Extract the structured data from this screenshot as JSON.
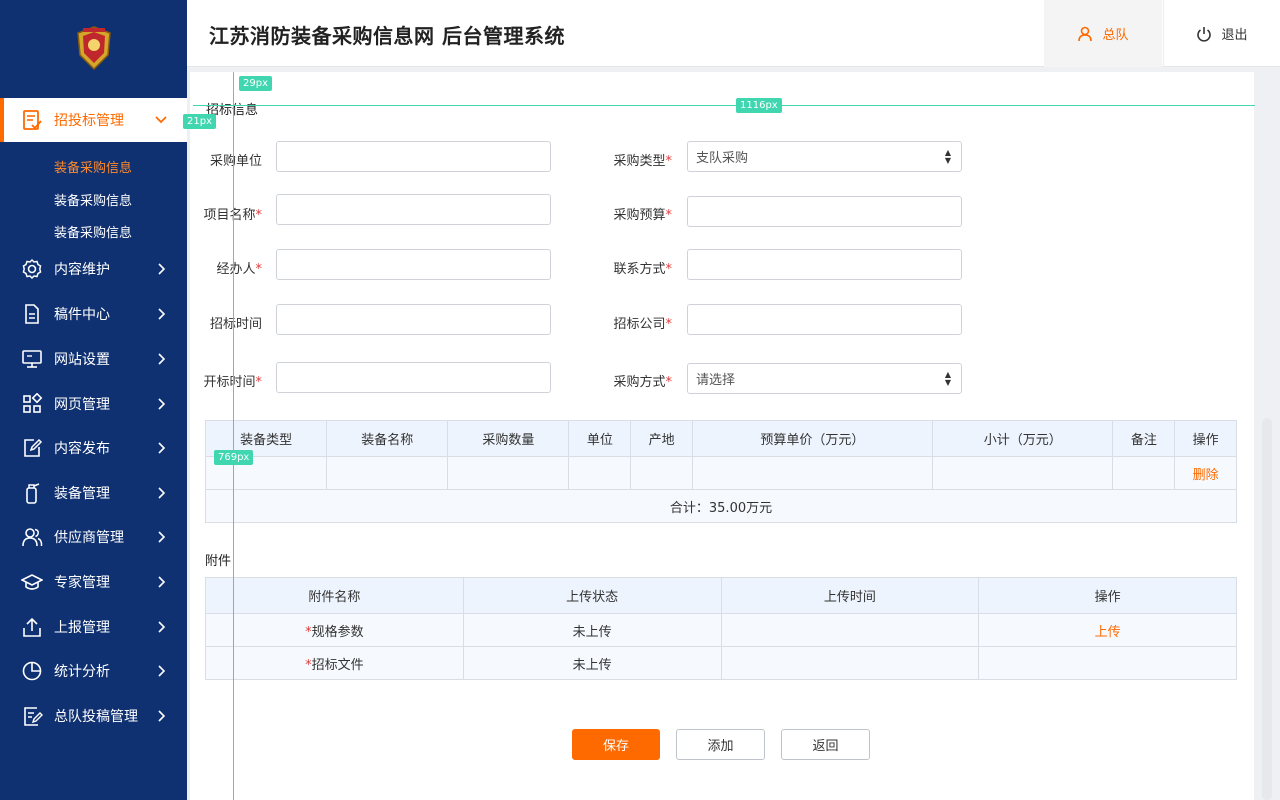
{
  "header": {
    "title": "江苏消防装备采购信息网  后台管理系统",
    "user_label": "总队",
    "logout_label": "退出"
  },
  "sidebar": {
    "active": {
      "label": "招投标管理",
      "icon": "document-check-icon"
    },
    "sub_items": [
      "装备采购信息",
      "装备采购信息",
      "装备采购信息"
    ],
    "items": [
      {
        "label": "内容维护",
        "icon": "gear-icon"
      },
      {
        "label": "稿件中心",
        "icon": "file-icon"
      },
      {
        "label": "网站设置",
        "icon": "monitor-icon"
      },
      {
        "label": "网页管理",
        "icon": "grid-icon"
      },
      {
        "label": "内容发布",
        "icon": "edit-icon"
      },
      {
        "label": "装备管理",
        "icon": "extinguisher-icon"
      },
      {
        "label": "供应商管理",
        "icon": "users-icon"
      },
      {
        "label": "专家管理",
        "icon": "graduation-icon"
      },
      {
        "label": "上报管理",
        "icon": "upload-icon"
      },
      {
        "label": "统计分析",
        "icon": "pie-chart-icon"
      },
      {
        "label": "总队投稿管理",
        "icon": "list-edit-icon"
      }
    ]
  },
  "form": {
    "section_title": "招标信息",
    "fields": {
      "unit": {
        "label": "采购单位",
        "required": false,
        "value": ""
      },
      "ptype": {
        "label": "采购类型",
        "required": true,
        "value": "支队采购"
      },
      "pname": {
        "label": "项目名称",
        "required": true,
        "value": ""
      },
      "budget": {
        "label": "采购预算",
        "required": true,
        "value": ""
      },
      "handler": {
        "label": "经办人",
        "required": true,
        "value": ""
      },
      "contact": {
        "label": "联系方式",
        "required": true,
        "value": ""
      },
      "bidtime": {
        "label": "招标时间",
        "required": false,
        "value": ""
      },
      "company": {
        "label": "招标公司",
        "required": true,
        "value": ""
      },
      "opentime": {
        "label": "开标时间",
        "required": true,
        "value": ""
      },
      "method": {
        "label": "采购方式",
        "required": true,
        "value": "请选择"
      }
    }
  },
  "equipment_table": {
    "headers": [
      "装备类型",
      "装备名称",
      "采购数量",
      "单位",
      "产地",
      "预算单价（万元）",
      "小计（万元）",
      "备注",
      "操作"
    ],
    "delete_label": "删除",
    "total": "合计：35.00万元"
  },
  "attachments": {
    "title": "附件",
    "headers": [
      "附件名称",
      "上传状态",
      "上传时间",
      "操作"
    ],
    "rows": [
      {
        "name": "规格参数",
        "status": "未上传",
        "time": "",
        "action": "上传"
      },
      {
        "name": "招标文件",
        "status": "未上传",
        "time": "",
        "action": ""
      }
    ]
  },
  "buttons": {
    "save": "保存",
    "add": "添加",
    "back": "返回"
  },
  "measurements": {
    "tag_29": "29px",
    "tag_21": "21px",
    "tag_1116": "1116px",
    "tag_769": "769px"
  },
  "colors": {
    "sidebar": "#0f3172",
    "accent": "#ff6a00",
    "guide": "#3fd6b0"
  }
}
